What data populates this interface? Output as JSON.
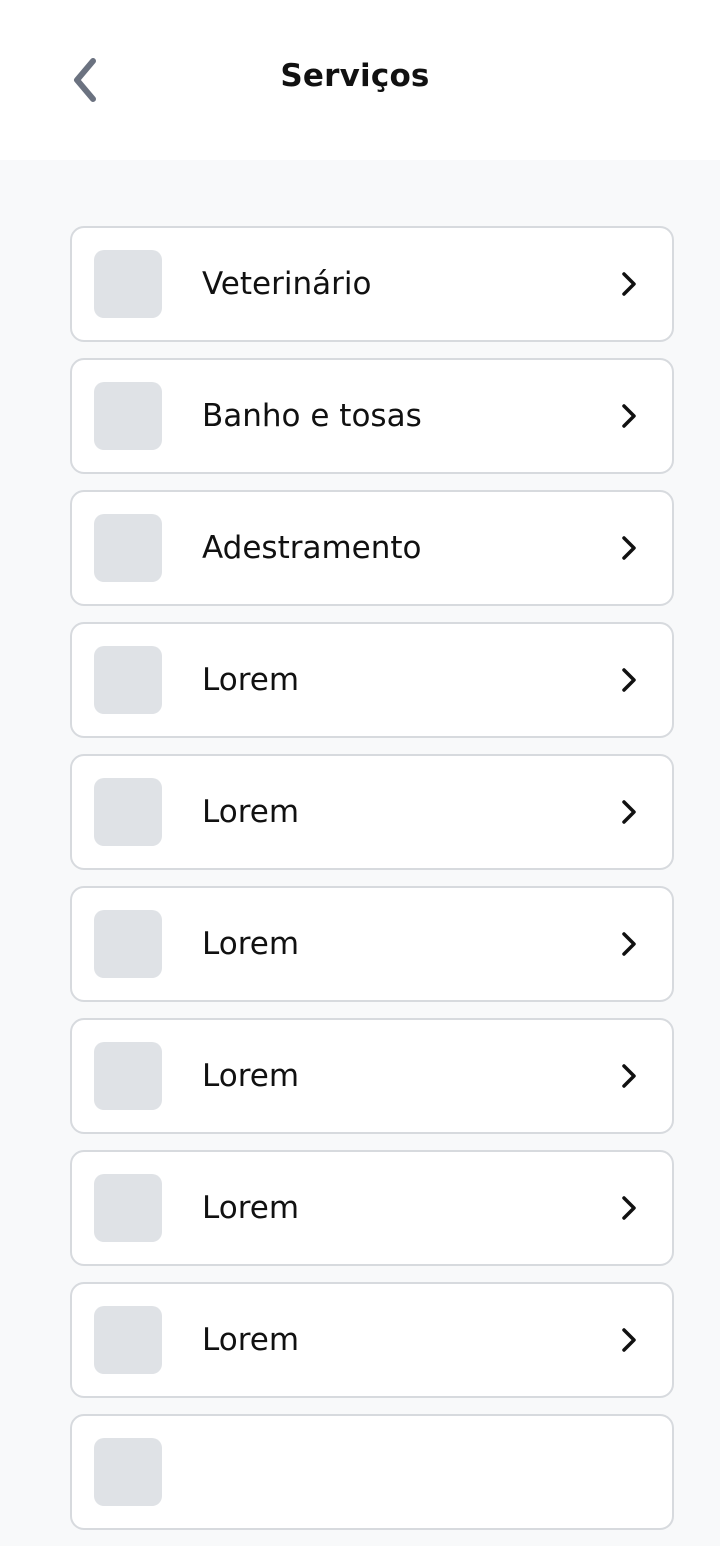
{
  "header": {
    "title": "Serviços",
    "back_icon": "chevron-left-icon"
  },
  "services": [
    {
      "label": "Veterinário"
    },
    {
      "label": "Banho e tosas"
    },
    {
      "label": "Adestramento"
    },
    {
      "label": "Lorem"
    },
    {
      "label": "Lorem"
    },
    {
      "label": "Lorem"
    },
    {
      "label": "Lorem"
    },
    {
      "label": "Lorem"
    },
    {
      "label": "Lorem"
    },
    {
      "label": ""
    }
  ],
  "colors": {
    "background": "#f8f9fa",
    "card": "#ffffff",
    "card_border": "#d7dade",
    "thumb_placeholder": "#dfe2e6",
    "back_icon": "#6b7280",
    "text": "#111111"
  }
}
